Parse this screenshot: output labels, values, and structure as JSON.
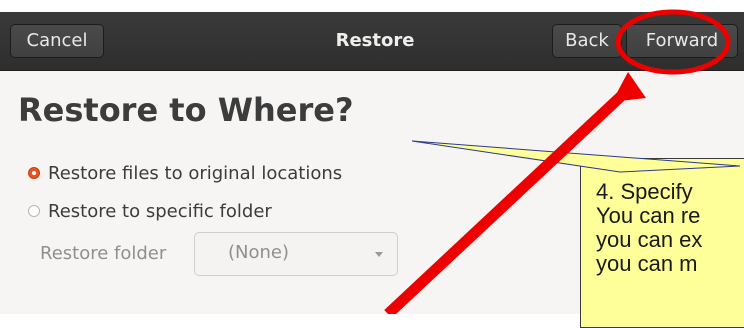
{
  "header": {
    "cancel_label": "Cancel",
    "title": "Restore",
    "back_label": "Back",
    "forward_label": "Forward"
  },
  "page": {
    "title": "Restore to Where?"
  },
  "options": {
    "original": {
      "label": "Restore files to original locations",
      "selected": true
    },
    "specific": {
      "label": "Restore to specific folder",
      "selected": false
    }
  },
  "restore_folder": {
    "label": "Restore folder",
    "value": "(None)"
  },
  "annotation": {
    "lines": [
      "4. Specify",
      "You can re",
      "you can ex",
      "you can m"
    ],
    "highlight_color": "#ee0000",
    "callout_color": "#ffff9a"
  }
}
